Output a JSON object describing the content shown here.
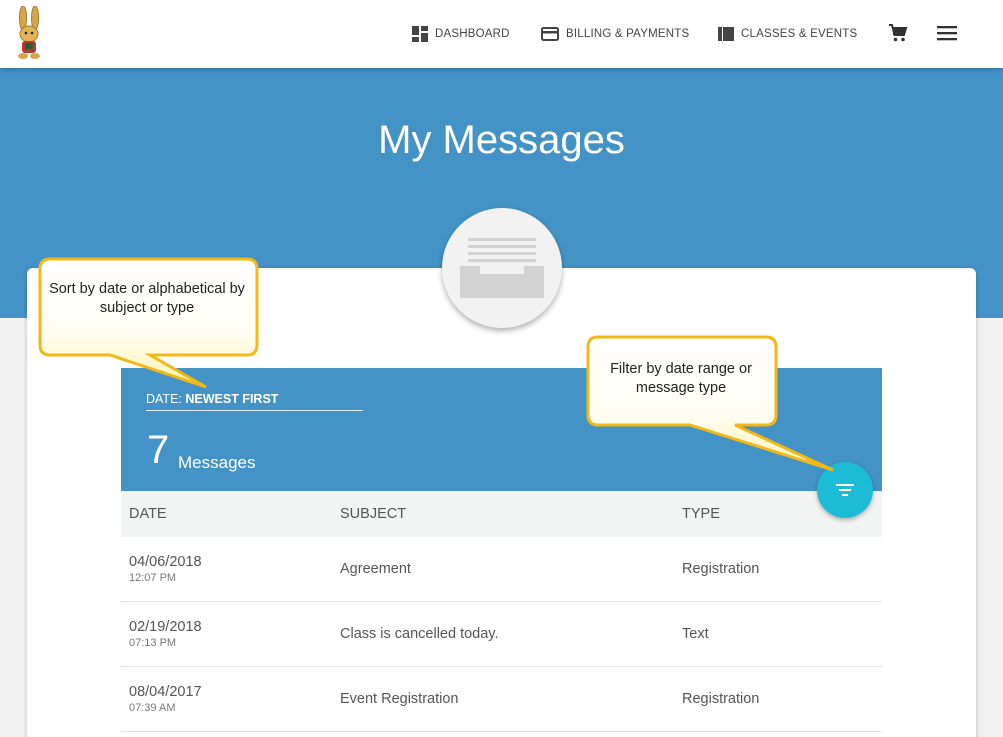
{
  "nav": {
    "dashboard": "DASHBOARD",
    "billing": "BILLING & PAYMENTS",
    "classes": "CLASSES & EVENTS"
  },
  "page": {
    "title": "My Messages"
  },
  "messages_panel": {
    "sort_prefix": "DATE: ",
    "sort_value": "NEWEST FIRST",
    "count": "7",
    "count_label": "Messages"
  },
  "table": {
    "columns": [
      "DATE",
      "SUBJECT",
      "TYPE"
    ],
    "rows": [
      {
        "date": "04/06/2018",
        "time": "12:07 PM",
        "subject": "Agreement",
        "type": "Registration"
      },
      {
        "date": "02/19/2018",
        "time": "07:13 PM",
        "subject": "Class is cancelled today.",
        "type": "Text"
      },
      {
        "date": "08/04/2017",
        "time": "07:39 AM",
        "subject": "Event Registration",
        "type": "Registration"
      }
    ]
  },
  "callouts": {
    "sort": "Sort by date or alphabetical by subject or type",
    "filter": "Filter by date range or message type"
  },
  "colors": {
    "header_blue": "#4493c6",
    "fab_teal": "#1cbcd7",
    "callout_fill": "#fffbcc",
    "callout_border": "#f2b816"
  },
  "icons": {
    "logo": "rabbit-logo-icon",
    "dashboard": "dashboard-grid-icon",
    "billing": "credit-card-icon",
    "classes": "book-icon",
    "cart": "cart-icon",
    "menu": "hamburger-menu-icon",
    "inbox": "inbox-tray-icon",
    "filter": "filter-icon"
  }
}
